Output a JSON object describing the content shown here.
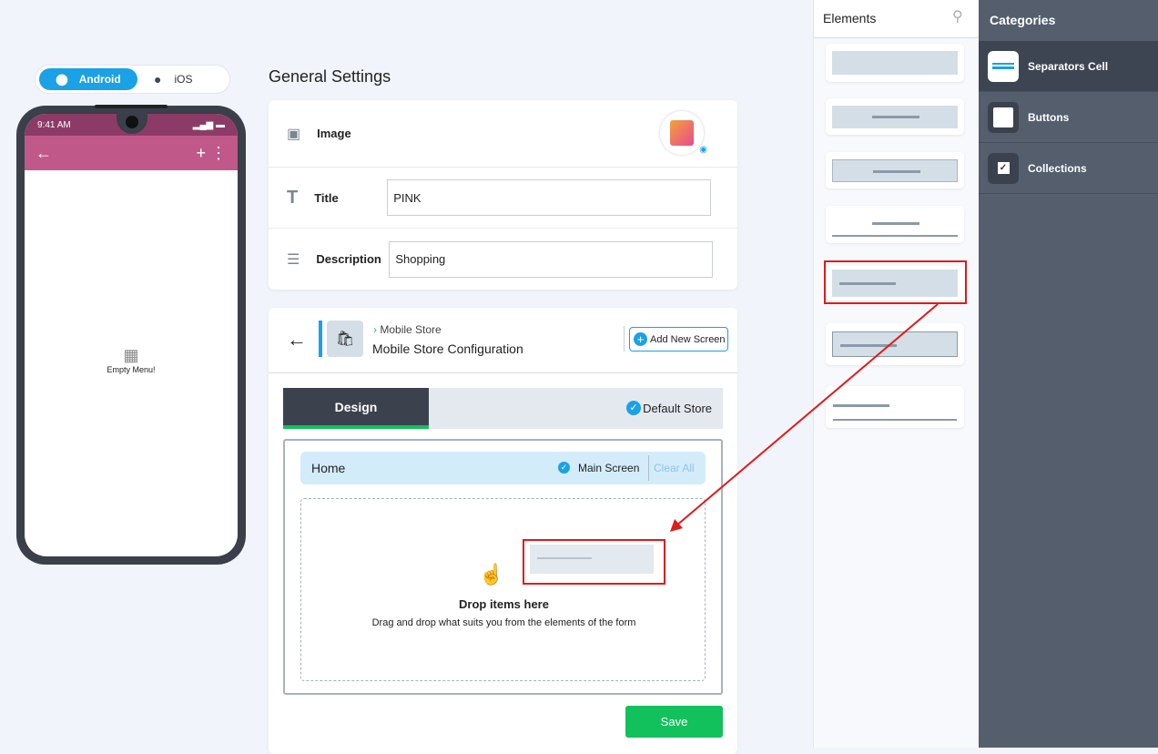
{
  "platform_toggle": {
    "android": "Android",
    "ios": "iOS",
    "selected": "Android"
  },
  "phone": {
    "time": "9:41 AM",
    "empty_text": "Empty Menu!",
    "appbar_color": "#c0598a"
  },
  "general": {
    "heading": "General Settings",
    "image_label": "Image",
    "title_label": "Title",
    "title_value": "PINK",
    "description_label": "Description",
    "description_value": "Shopping"
  },
  "config": {
    "breadcrumb": "Mobile Store",
    "title": "Mobile Store Configuration",
    "add_screen": "Add New Screen",
    "tab_design": "Design",
    "default_store": "Default Store",
    "screen_name": "Home",
    "main_screen": "Main Screen",
    "clear_all": "Clear All",
    "drop_title": "Drop items here",
    "drop_sub": "Drag and drop what suits you from the elements of the form",
    "save": "Save"
  },
  "elements": {
    "title": "Elements"
  },
  "categories": {
    "title": "Categories",
    "items": [
      {
        "label": "Separators Cell",
        "active": true
      },
      {
        "label": "Buttons"
      },
      {
        "label": "Collections"
      }
    ]
  },
  "colors": {
    "accent": "#1ba1e6",
    "save": "#12c15c",
    "highlight": "#e01b1b"
  }
}
